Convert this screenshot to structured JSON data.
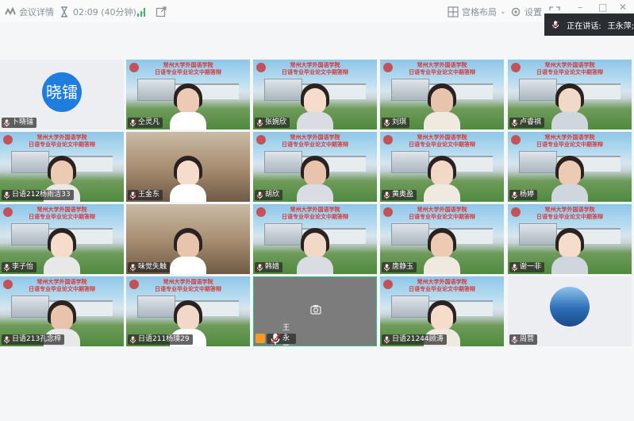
{
  "topbar": {
    "meeting_details": "会议详情",
    "timer": "02:09 (40分钟)",
    "layout_label": "宫格布局",
    "settings_label": "设置"
  },
  "speaking": {
    "label": "正在讲话:",
    "name": "王永萍;"
  },
  "participants": [
    {
      "name": "卜晓镭",
      "avatar_text": "晓镭",
      "kind": "avatar"
    },
    {
      "name": "仝灵凡",
      "kind": "campus"
    },
    {
      "name": "张婉欣",
      "kind": "campus"
    },
    {
      "name": "刘琪",
      "kind": "campus"
    },
    {
      "name": "卢睿祺",
      "kind": "campus"
    },
    {
      "name": "日语212杨雨洁33",
      "kind": "campus"
    },
    {
      "name": "王金东",
      "kind": "room"
    },
    {
      "name": "胡欣",
      "kind": "campus"
    },
    {
      "name": "黄奥盈",
      "kind": "campus"
    },
    {
      "name": "杨婷",
      "kind": "campus"
    },
    {
      "name": "李子怡",
      "kind": "campus"
    },
    {
      "name": "味觉失触",
      "kind": "room"
    },
    {
      "name": "韩婧",
      "kind": "campus"
    },
    {
      "name": "唐静玉",
      "kind": "campus"
    },
    {
      "name": "谢一非",
      "kind": "campus"
    },
    {
      "name": "日语213孔念梓",
      "kind": "campus"
    },
    {
      "name": "日语211杨璞29",
      "kind": "campus"
    },
    {
      "name": "王永萍",
      "kind": "self"
    },
    {
      "name": "日语21244顾涛",
      "kind": "campus"
    },
    {
      "name": "周营",
      "kind": "photo"
    }
  ],
  "banner": {
    "line1": "常州大学外国语学院",
    "line2": "日语专业毕业论文中期答辩"
  },
  "colors": {
    "accent": "#1f7de0",
    "speaking_border": "#2fbf8a",
    "banner_text": "#d63a3a"
  }
}
